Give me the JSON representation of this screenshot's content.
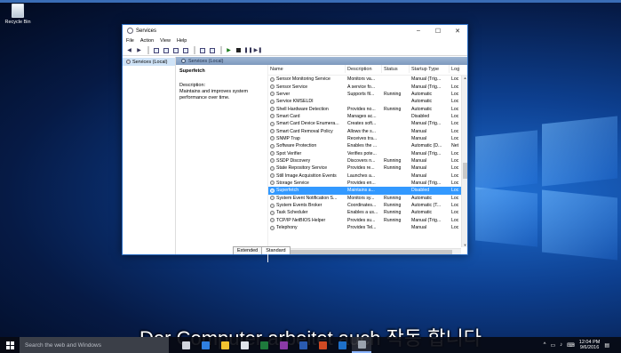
{
  "desktop": {
    "recycle_bin_label": "Recycle Bin"
  },
  "window": {
    "title": "Services",
    "controls": {
      "minimize": "–",
      "maximize": "☐",
      "close": "✕"
    },
    "menu": [
      "File",
      "Action",
      "View",
      "Help"
    ],
    "tree_item": "Services (Local)",
    "header": "Services (Local)",
    "detail": {
      "service_name": "Superfetch",
      "description_label": "Description:",
      "description_text": "Maintains and improves system performance over time."
    },
    "columns": {
      "name": "Name",
      "description": "Description",
      "status": "Status",
      "startup": "Startup Type",
      "log": "Log"
    },
    "rows": [
      {
        "name": "Sensor Monitoring Service",
        "description": "Monitors va...",
        "status": "",
        "startup": "Manual (Trig...",
        "log": "Loc"
      },
      {
        "name": "Sensor Service",
        "description": "A service fo...",
        "status": "",
        "startup": "Manual (Trig...",
        "log": "Loc"
      },
      {
        "name": "Server",
        "description": "Supports fil...",
        "status": "Running",
        "startup": "Automatic",
        "log": "Loc"
      },
      {
        "name": "Service KMSELDI",
        "description": "",
        "status": "",
        "startup": "Automatic",
        "log": "Loc"
      },
      {
        "name": "Shell Hardware Detection",
        "description": "Provides no...",
        "status": "Running",
        "startup": "Automatic",
        "log": "Loc"
      },
      {
        "name": "Smart Card",
        "description": "Manages ac...",
        "status": "",
        "startup": "Disabled",
        "log": "Loc"
      },
      {
        "name": "Smart Card Device Enumera...",
        "description": "Creates soft...",
        "status": "",
        "startup": "Manual (Trig...",
        "log": "Loc"
      },
      {
        "name": "Smart Card Removal Policy",
        "description": "Allows the s...",
        "status": "",
        "startup": "Manual",
        "log": "Loc"
      },
      {
        "name": "SNMP Trap",
        "description": "Receives tra...",
        "status": "",
        "startup": "Manual",
        "log": "Loc"
      },
      {
        "name": "Software Protection",
        "description": "Enables the ...",
        "status": "",
        "startup": "Automatic (D...",
        "log": "Net"
      },
      {
        "name": "Spot Verifier",
        "description": "Verifies pote...",
        "status": "",
        "startup": "Manual (Trig...",
        "log": "Loc"
      },
      {
        "name": "SSDP Discovery",
        "description": "Discovers n...",
        "status": "Running",
        "startup": "Manual",
        "log": "Loc"
      },
      {
        "name": "State Repository Service",
        "description": "Provides re...",
        "status": "Running",
        "startup": "Manual",
        "log": "Loc"
      },
      {
        "name": "Still Image Acquisition Events",
        "description": "Launches a...",
        "status": "",
        "startup": "Manual",
        "log": "Loc"
      },
      {
        "name": "Storage Service",
        "description": "Provides en...",
        "status": "",
        "startup": "Manual (Trig...",
        "log": "Loc"
      },
      {
        "name": "Superfetch",
        "description": "Maintains a...",
        "status": "",
        "startup": "Disabled",
        "log": "Loc",
        "selected": true
      },
      {
        "name": "System Event Notification S...",
        "description": "Monitors sy...",
        "status": "Running",
        "startup": "Automatic",
        "log": "Loc"
      },
      {
        "name": "System Events Broker",
        "description": "Coordinates...",
        "status": "Running",
        "startup": "Automatic (T...",
        "log": "Loc"
      },
      {
        "name": "Task Scheduler",
        "description": "Enables a us...",
        "status": "Running",
        "startup": "Automatic",
        "log": "Loc"
      },
      {
        "name": "TCP/IP NetBIOS Helper",
        "description": "Provides su...",
        "status": "Running",
        "startup": "Manual (Trig...",
        "log": "Loc"
      },
      {
        "name": "Telephony",
        "description": "Provides Tel...",
        "status": "",
        "startup": "Manual",
        "log": "Loc"
      }
    ],
    "tabs": [
      "Extended",
      "Standard"
    ]
  },
  "subtitle": "Der Computer arbeitet auch 작동 합니다",
  "taskbar": {
    "search_placeholder": "Search the web and Windows",
    "apps": [
      {
        "icon": "task-view-icon",
        "color": "#d0d4dc"
      },
      {
        "icon": "edge-icon",
        "color": "#2f7fe0"
      },
      {
        "icon": "file-explorer-icon",
        "color": "#f2c230"
      },
      {
        "icon": "store-icon",
        "color": "#e0e4ea"
      },
      {
        "icon": "excel-icon",
        "color": "#1e7a3c"
      },
      {
        "icon": "onenote-icon",
        "color": "#8a3aa6"
      },
      {
        "icon": "word-icon",
        "color": "#2a5bb0"
      },
      {
        "icon": "powerpoint-icon",
        "color": "#d04a23"
      },
      {
        "icon": "outlook-icon",
        "color": "#1e6fc8"
      },
      {
        "icon": "services-icon",
        "color": "#9aa2ad"
      }
    ],
    "time": "12:04 PM",
    "date": "9/6/2016"
  }
}
